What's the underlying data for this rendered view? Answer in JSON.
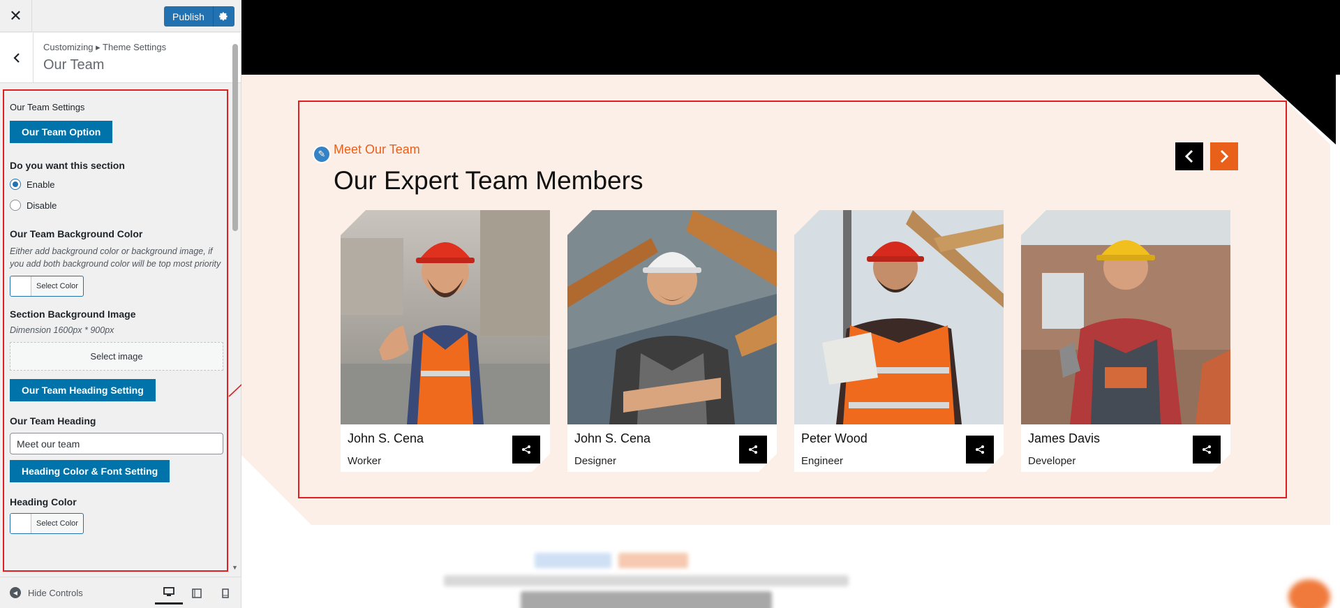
{
  "topbar": {
    "close_icon": "close-icon",
    "publish_label": "Publish",
    "settings_icon": "gear-icon"
  },
  "section": {
    "breadcrumb": "Customizing ▸ Theme Settings",
    "title": "Our Team"
  },
  "controls": {
    "settings_label": "Our Team Settings",
    "option_button": "Our Team Option",
    "section_question": "Do you want this section",
    "radio_enable": "Enable",
    "radio_disable": "Disable",
    "radio_selected": "Enable",
    "bg_color_title": "Our Team Background Color",
    "bg_color_desc": "Either add background color or background image, if you add both background color will be top most priority",
    "select_color": "Select Color",
    "bg_image_title": "Section Background Image",
    "bg_image_desc": "Dimension 1600px * 900px",
    "select_image": "Select image",
    "heading_setting_button": "Our Team Heading Setting",
    "heading_label": "Our Team Heading",
    "heading_value": "Meet our team",
    "font_setting_button": "Heading Color & Font Setting",
    "heading_color_title": "Heading Color",
    "heading_color_select": "Select Color"
  },
  "footer": {
    "hide_controls": "Hide Controls"
  },
  "preview": {
    "eyebrow": "Meet Our Team",
    "heading": "Our Expert Team Members",
    "accent_color": "#e8601a",
    "members": [
      {
        "name": "John S. Cena",
        "role": "Worker"
      },
      {
        "name": "John S. Cena",
        "role": "Designer"
      },
      {
        "name": "Peter Wood",
        "role": "Engineer"
      },
      {
        "name": "James Davis",
        "role": "Developer"
      }
    ]
  }
}
